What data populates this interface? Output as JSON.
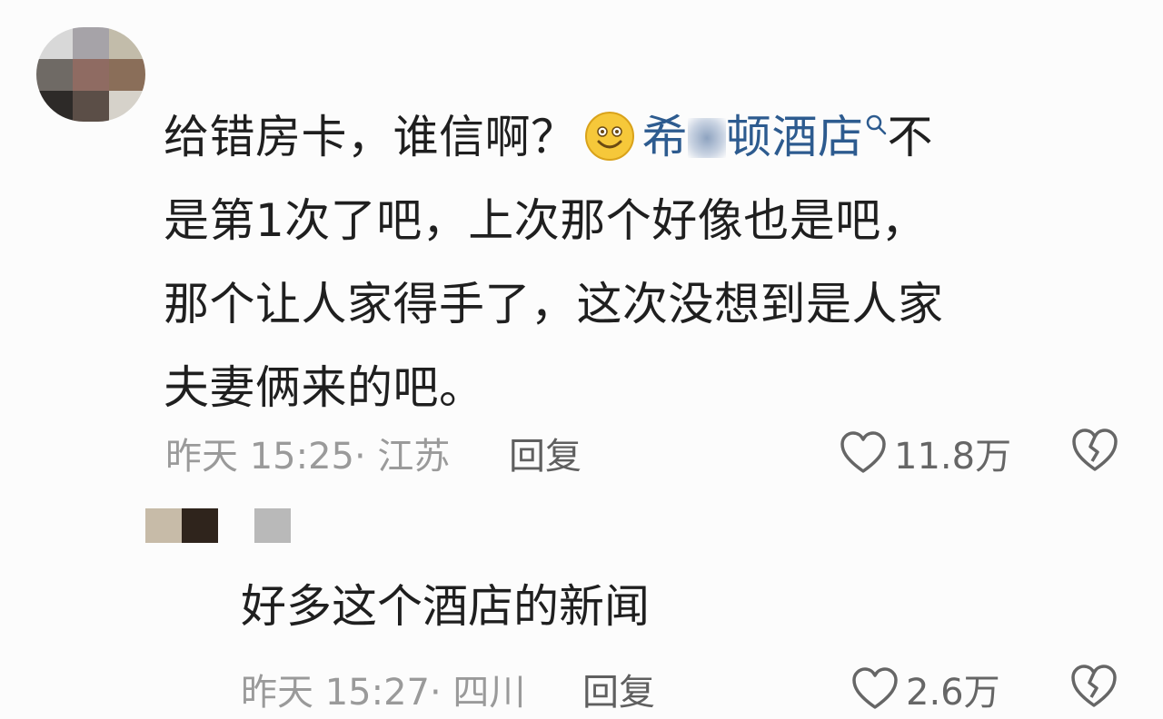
{
  "comment": {
    "line1_prefix": "给错房卡，谁信啊？",
    "topic_part1": "希",
    "topic_part2": "顿酒店",
    "line1_suffix": "不",
    "line2": "是第1次了吧，上次那个好像也是吧，",
    "line3": "那个让人家得手了，这次没想到是人家",
    "line4": "夫妻俩来的吧。",
    "time": "昨天 15:25· 江苏",
    "reply_label": "回复",
    "like_count": "11.8万"
  },
  "reply": {
    "text": "好多这个酒店的新闻",
    "time": "昨天 15:27· 四川",
    "reply_label": "回复",
    "like_count": "2.6万"
  },
  "colors": {
    "topic_link": "#2d5b8f",
    "meta_gray": "#9a9a9a",
    "text": "#1f1f1f",
    "background": "#fcfcfc"
  },
  "icons": {
    "emoji": "smile-emoji-icon",
    "search": "search-icon",
    "like": "heart-icon",
    "dislike": "broken-heart-icon"
  }
}
